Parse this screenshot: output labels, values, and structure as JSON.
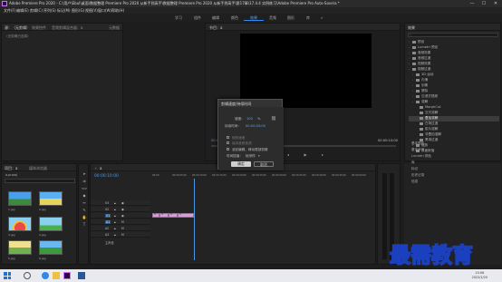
{
  "window": {
    "title": "Adobe Premiere Pro 2020 - C:\\用户\\Ebul\\桌面\\数据整理 Premiere Pro 2020 从新手到高手\\数据整理 Premiere Pro 2020 从新手到高手\\第17章\\17.4.4 实例练习\\Adobe Premiere Pro Auto-Save\\a *",
    "minimize": "—",
    "maximize": "☐",
    "close": "✕"
  },
  "menu": [
    "文件(F)",
    "编辑(E)",
    "剪辑(C)",
    "序列(S)",
    "标记(M)",
    "图形(G)",
    "视图(V)",
    "窗口(W)",
    "帮助(H)"
  ],
  "workspaces": [
    "学习",
    "组件",
    "编辑",
    "颜色",
    "效果",
    "音频",
    "图形",
    "库",
    "»"
  ],
  "workspace_active": "效果",
  "source": {
    "tabs": [
      "源：（无剪辑）",
      "效果控件",
      "音频剪辑混合器：a",
      "元数据"
    ],
    "message": "（无剪辑已选择）"
  },
  "program": {
    "tab": "节目：a",
    "timecode": "00:00:00:00",
    "duration": "00:00:10:00"
  },
  "effects": {
    "tab": "效果",
    "items": [
      {
        "label": "预设",
        "depth": 0,
        "selected": false
      },
      {
        "label": "Lumetri 预设",
        "depth": 0,
        "selected": false
      },
      {
        "label": "音频效果",
        "depth": 0,
        "selected": false
      },
      {
        "label": "音频过渡",
        "depth": 0,
        "selected": false
      },
      {
        "label": "视频效果",
        "depth": 0,
        "selected": false
      },
      {
        "label": "视频过渡",
        "depth": 0,
        "selected": false
      },
      {
        "label": "3D 运动",
        "depth": 1,
        "selected": false
      },
      {
        "label": "内滑",
        "depth": 1,
        "selected": false
      },
      {
        "label": "划像",
        "depth": 1,
        "selected": false
      },
      {
        "label": "擦除",
        "depth": 1,
        "selected": false
      },
      {
        "label": "沉浸式视频",
        "depth": 1,
        "selected": false
      },
      {
        "label": "溶解",
        "depth": 1,
        "selected": false
      },
      {
        "label": "MorphCut",
        "depth": 2,
        "selected": false
      },
      {
        "label": "交叉溶解",
        "depth": 2,
        "selected": false
      },
      {
        "label": "叠加溶解",
        "depth": 2,
        "selected": true
      },
      {
        "label": "白场过渡",
        "depth": 2,
        "selected": false
      },
      {
        "label": "胶片溶解",
        "depth": 2,
        "selected": false
      },
      {
        "label": "非叠加溶解",
        "depth": 2,
        "selected": false
      },
      {
        "label": "黑场过渡",
        "depth": 2,
        "selected": false
      },
      {
        "label": "缩放",
        "depth": 1,
        "selected": false
      },
      {
        "label": "页面剥落",
        "depth": 1,
        "selected": false
      }
    ],
    "lower_labels": [
      "基本图形",
      "基本声音",
      "Lumetri 颜色",
      "库",
      "标记",
      "历史记录",
      "信息"
    ]
  },
  "project": {
    "tabs": [
      "项目：a",
      "媒体浏览器"
    ],
    "name": "a.prproj",
    "thumb_labels": [
      "1.jpg",
      "2.jpg",
      "3.jpg",
      "4.jpg",
      "5.jpg",
      "6.jpg"
    ]
  },
  "timeline": {
    "tab": "a",
    "timecode": "00:00:10:00",
    "ruler": [
      "00:00",
      "00:00:05:00",
      "00:00:10:00",
      "00:00:15:00",
      "00:00:20:00",
      "00:00:25:00",
      "00:00:30:00",
      "00:00:35:00",
      "00:00:40:00",
      "00:00:45:00",
      "00:00:50:00"
    ],
    "tracks": [
      {
        "name": "V3",
        "on": false
      },
      {
        "name": "V2",
        "on": false
      },
      {
        "name": "V1",
        "on": true
      },
      {
        "name": "A1",
        "on": true
      },
      {
        "name": "A2",
        "on": false
      },
      {
        "name": "A3",
        "on": false
      }
    ],
    "master": "主声道",
    "clip_labels": [
      "fx",
      "fx",
      "fx",
      "fx"
    ]
  },
  "dialog": {
    "title": "剪辑速度/持续时间",
    "speed_label": "速度：",
    "speed_value": "100",
    "speed_unit": "%",
    "duration_label": "持续时间：",
    "duration_value": "00:00:03:00",
    "reverse_label": "倒放速度",
    "audio_label": "保持音频音调",
    "ripple_label": "波纹编辑，移动尾部剪辑",
    "interp_label": "时间插值：",
    "interp_value": "帧采样",
    "ok": "确定",
    "cancel": "取消"
  },
  "taskbar": {
    "clock_time": "15:06",
    "clock_date": "2022/1/20"
  },
  "watermark": "最需教育"
}
